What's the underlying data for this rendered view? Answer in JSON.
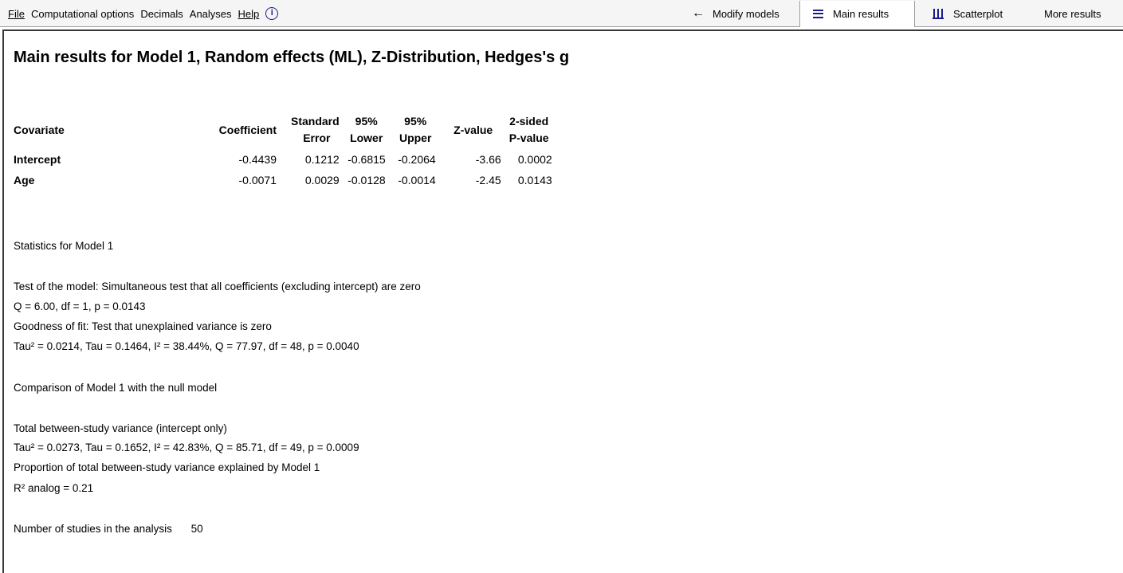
{
  "menu": {
    "file": "File",
    "computational_options": "Computational options",
    "decimals": "Decimals",
    "analyses": "Analyses",
    "help": "Help"
  },
  "toolbar": {
    "modify_models": "Modify models",
    "main_results": "Main results",
    "scatterplot": "Scatterplot",
    "more_results": "More results"
  },
  "title": "Main results for Model 1, Random effects (ML), Z-Distribution, Hedges's g",
  "table": {
    "headers": {
      "covariate": "Covariate",
      "coefficient": "Coefficient",
      "se_1": "Standard",
      "se_2": "Error",
      "lower_1": "95%",
      "lower_2": "Lower",
      "upper_1": "95%",
      "upper_2": "Upper",
      "z": "Z-value",
      "p_1": "2-sided",
      "p_2": "P-value"
    },
    "rows": [
      {
        "covariate": "Intercept",
        "coefficient": "-0.4439",
        "se": "0.1212",
        "lower": "-0.6815",
        "upper": "-0.2064",
        "z": "-3.66",
        "p": "0.0002"
      },
      {
        "covariate": "Age",
        "coefficient": "-0.0071",
        "se": "0.0029",
        "lower": "-0.0128",
        "upper": "-0.0014",
        "z": "-2.45",
        "p": "0.0143"
      }
    ]
  },
  "stats": {
    "heading": "Statistics for Model 1",
    "test_model_heading": "Test of the model: Simultaneous test that all coefficients (excluding intercept) are zero",
    "test_model_value": "Q = 6.00, df = 1, p = 0.0143",
    "gof_heading": "Goodness of fit:  Test that unexplained variance is zero",
    "gof_value": "Tau² = 0.0214, Tau = 0.1464, I² = 38.44%, Q = 77.97, df = 48, p = 0.0040",
    "comparison_heading": "Comparison of Model 1 with the null model",
    "total_var_heading": "Total between-study variance (intercept only)",
    "total_var_value": "Tau² = 0.0273, Tau = 0.1652, I² = 42.83%, Q = 85.71, df = 49, p = 0.0009",
    "proportion_heading": "Proportion of total between-study variance explained by Model 1",
    "r2_value": "R² analog = 0.21",
    "n_studies_label": "Number of studies in the analysis",
    "n_studies_value": "50"
  }
}
